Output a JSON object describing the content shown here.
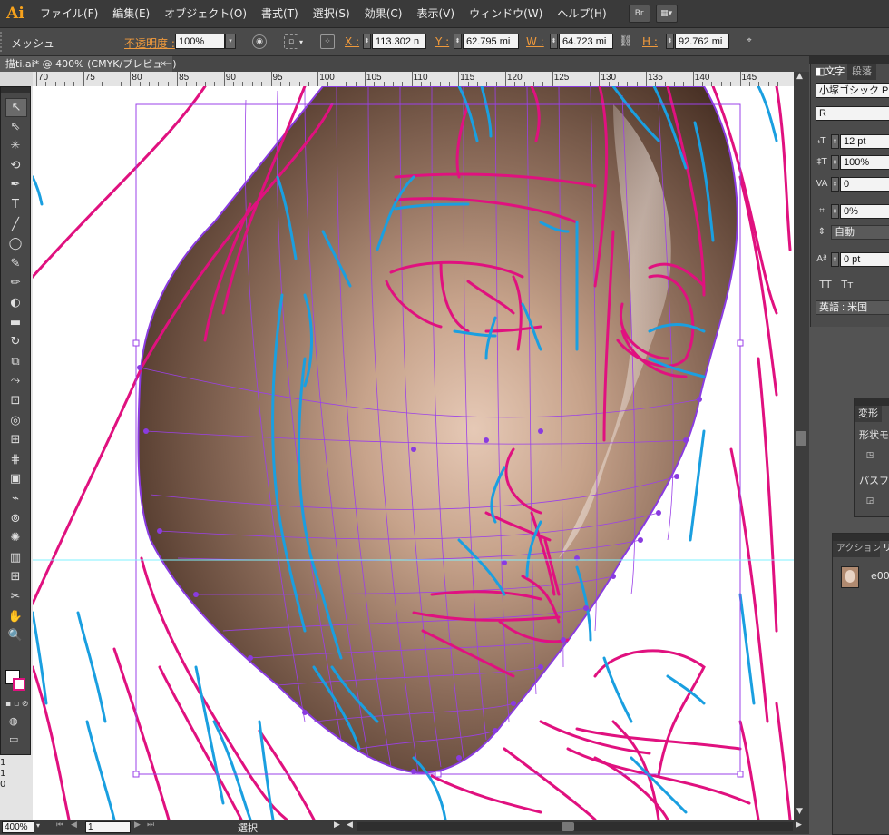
{
  "app": {
    "logo": "Ai",
    "menu": [
      "ファイル(F)",
      "編集(E)",
      "オブジェクト(O)",
      "書式(T)",
      "選択(S)",
      "効果(C)",
      "表示(V)",
      "ウィンドウ(W)",
      "ヘルプ(H)"
    ],
    "bridge_label": "Br"
  },
  "control": {
    "object_type": "メッシュ",
    "opacity_label": "不透明度 :",
    "opacity_value": "100%",
    "x_label": "X :",
    "x_value": "113.302 n",
    "y_label": "Y :",
    "y_value": "62.795 mi",
    "w_label": "W :",
    "w_value": "64.723 mi",
    "h_label": "H :",
    "h_value": "92.762 mi"
  },
  "document": {
    "tab_title": "描ti.ai* @ 400% (CMYK/プレビュー)",
    "close": "×"
  },
  "ruler": {
    "top_labels": [
      "70",
      "75",
      "80",
      "85",
      "90",
      "95",
      "100",
      "105",
      "110",
      "115",
      "120",
      "125",
      "130",
      "135",
      "140",
      "145"
    ],
    "left_labels": [
      "1",
      "1",
      "0"
    ]
  },
  "status": {
    "zoom": "400%",
    "page": "1",
    "tool": "選択"
  },
  "character_panel": {
    "tab_character": "文字",
    "tab_paragraph": "段落",
    "font_family": "小塚ゴシック P",
    "font_style": "R",
    "size": "12 pt",
    "vertical_scale": "100%",
    "tracking": "0",
    "tsume": "0%",
    "leading": "自動",
    "baseline_shift": "0 pt",
    "caps_buttons": [
      "TT",
      "Tт"
    ],
    "language": "英語 : 米国"
  },
  "transform_panel": {
    "title": "変形",
    "shape_mode": "形状モ",
    "pathfinder": "パスフ"
  },
  "actions_panel": {
    "tab_actions": "アクション",
    "tab_links": "リ",
    "item": "e00"
  },
  "colors": {
    "ui_dark": "#3a3a3a",
    "ui_panel": "#4b4b4b",
    "accent_orange": "#f09a3c",
    "path_magenta": "#e0117f",
    "path_blue": "#1a9fe0",
    "mesh_purple": "#9b40e8",
    "guide_cyan": "#7ff0ff"
  },
  "icons": [
    "selection-tool-icon",
    "direct-selection-tool-icon",
    "magic-wand-icon",
    "lasso-icon",
    "pen-tool-icon",
    "type-tool-icon",
    "line-tool-icon",
    "ellipse-tool-icon",
    "paintbrush-icon",
    "pencil-icon",
    "blob-brush-icon",
    "eraser-icon",
    "rotate-icon",
    "scale-icon",
    "warp-icon",
    "free-transform-icon",
    "shape-builder-icon",
    "perspective-grid-icon",
    "mesh-tool-icon",
    "gradient-tool-icon",
    "eyedropper-icon",
    "blend-tool-icon",
    "symbol-sprayer-icon",
    "graph-tool-icon",
    "artboard-tool-icon",
    "slice-tool-icon",
    "hand-tool-icon",
    "zoom-tool-icon"
  ]
}
